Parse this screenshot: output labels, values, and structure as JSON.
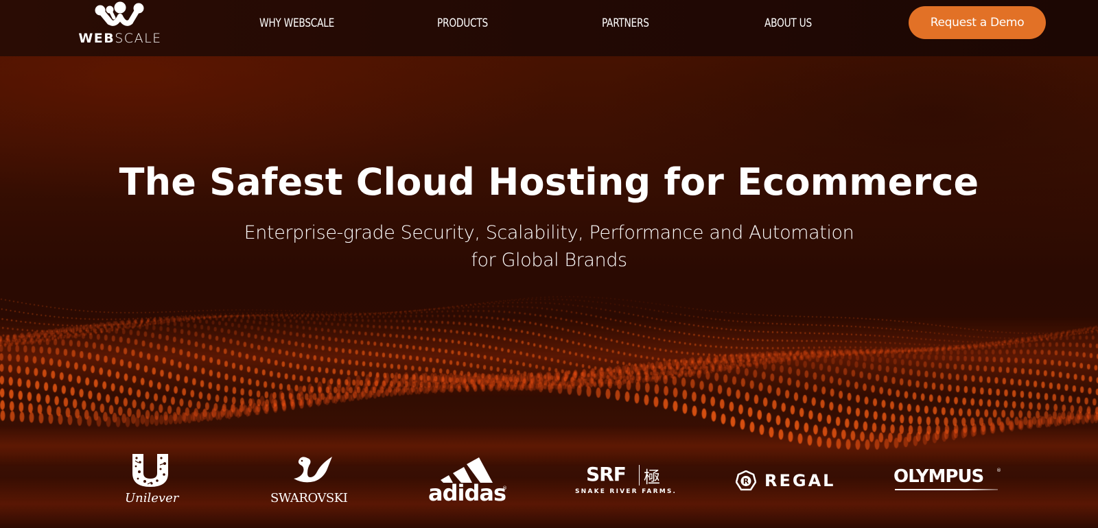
{
  "brand": {
    "name_bold": "WEB",
    "name_light": "SCALE",
    "logo_icon": "webscale-molecule-icon"
  },
  "nav": {
    "items": [
      {
        "label": "WHY WEBSCALE"
      },
      {
        "label": "PRODUCTS"
      },
      {
        "label": "PARTNERS"
      },
      {
        "label": "ABOUT US"
      }
    ],
    "cta_label": "Request a Demo"
  },
  "hero": {
    "headline": "The Safest Cloud Hosting for Ecommerce",
    "subline_1": "Enterprise-grade Security, Scalability, Performance and Automation",
    "subline_2": "for Global Brands",
    "background_icon": "particle-wave-graphic"
  },
  "clients": [
    {
      "name": "Unilever",
      "label": "Unilever",
      "icon": "unilever-logo-icon"
    },
    {
      "name": "Swarovski",
      "label": "SWAROVSKI",
      "icon": "swarovski-swan-icon"
    },
    {
      "name": "adidas",
      "label": "adidas",
      "icon": "adidas-stripes-icon"
    },
    {
      "name": "Snake River Farms",
      "label": "SRF",
      "sub_label": "SNAKE RIVER FARMS.",
      "kanji": "極",
      "icon": "srf-logo-icon"
    },
    {
      "name": "Regal",
      "label": "REGAL",
      "icon": "regal-logo-icon"
    },
    {
      "name": "Olympus",
      "label": "OLYMPUS",
      "icon": "olympus-logo-icon"
    }
  ],
  "colors": {
    "accent": "#e27126",
    "header_bg": "#220904",
    "hero_bg": "#3a0f02",
    "wave": "#ff5a10"
  }
}
